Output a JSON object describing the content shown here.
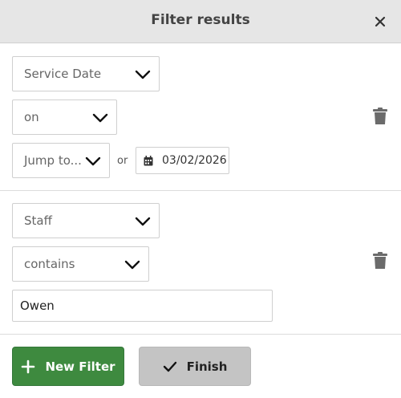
{
  "dialog": {
    "title": "Filter results",
    "close_icon": "close-icon"
  },
  "filters": [
    {
      "field": "Service Date",
      "operator": "on",
      "jump": "Jump to...",
      "or_text": "or",
      "date_value": "03/02/2026"
    },
    {
      "field": "Staff",
      "operator": "contains",
      "value": "Owen"
    }
  ],
  "footer": {
    "new_filter_label": "New Filter",
    "finish_label": "Finish"
  },
  "colors": {
    "primary_button": "#3e8a3f",
    "secondary_button": "#c4c4c4",
    "header_bg": "#e6e6e6"
  }
}
